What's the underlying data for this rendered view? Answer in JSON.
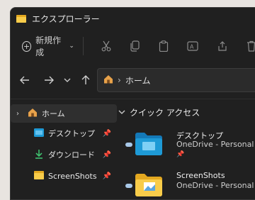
{
  "window": {
    "title": "エクスプローラー"
  },
  "toolbar": {
    "new_label": "新規作成"
  },
  "address": {
    "location": "ホーム"
  },
  "sidebar": {
    "items": [
      {
        "label": "ホーム",
        "icon": "home-icon",
        "selected": true
      },
      {
        "label": "デスクトップ",
        "icon": "desktop-folder-icon",
        "pinned": true
      },
      {
        "label": "ダウンロード",
        "icon": "download-icon",
        "pinned": true
      },
      {
        "label": "ScreenShots",
        "icon": "folder-icon",
        "pinned": true
      }
    ]
  },
  "main": {
    "section_title": "クイック アクセス",
    "items": [
      {
        "name": "デスクトップ",
        "location": "OneDrive - Personal"
      },
      {
        "name": "ScreenShots",
        "location": "OneDrive - Personal"
      }
    ]
  },
  "colors": {
    "window_bg": "#202020",
    "folder_yellow": "#f8cc4a",
    "desktop_blue": "#1e9ad6",
    "home_orange": "#e8a24a"
  }
}
